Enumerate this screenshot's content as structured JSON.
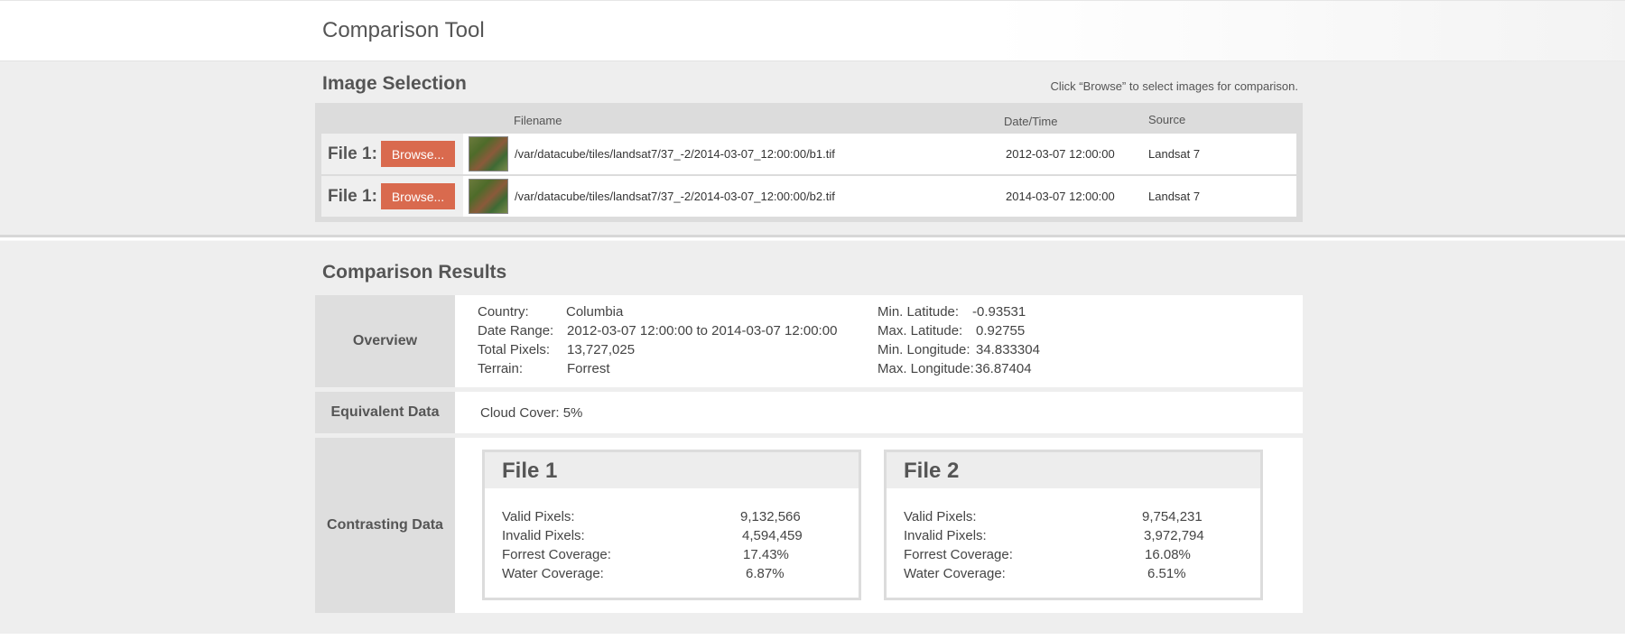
{
  "app": {
    "title": "Comparison Tool"
  },
  "selection": {
    "title": "Image Selection",
    "hint": "Click “Browse” to select images for comparison.",
    "columns": {
      "filename": "Filename",
      "datetime": "Date/Time",
      "source": "Source"
    },
    "rows": [
      {
        "label": "File 1:",
        "button": "Browse...",
        "filename": "/var/datacube/tiles/landsat7/37_-2/2014-03-07_12:00:00/b1.tif",
        "datetime": "2012-03-07 12:00:00",
        "source": "Landsat 7"
      },
      {
        "label": "File 1:",
        "button": "Browse...",
        "filename": "/var/datacube/tiles/landsat7/37_-2/2014-03-07_12:00:00/b2.tif",
        "datetime": "2014-03-07 12:00:00",
        "source": "Landsat 7"
      }
    ]
  },
  "results": {
    "title": "Comparison Results",
    "overview": {
      "label": "Overview",
      "left": [
        {
          "key": "Country:",
          "value": "Columbia"
        },
        {
          "key": "Date Range:",
          "value": "2012-03-07 12:00:00 to 2014-03-07 12:00:00"
        },
        {
          "key": "Total Pixels:",
          "value": "13,727,025"
        },
        {
          "key": "Terrain:",
          "value": "Forrest"
        }
      ],
      "right": [
        {
          "key": "Min. Latitude:",
          "value": "-0.93531"
        },
        {
          "key": "Max. Latitude:",
          "value": "0.92755"
        },
        {
          "key": "Min. Longitude:",
          "value": "34.833304"
        },
        {
          "key": "Max. Longitude:",
          "value": "36.87404"
        }
      ]
    },
    "equivalent": {
      "label": "Equivalent Data",
      "text": "Cloud Cover: 5%"
    },
    "contrasting": {
      "label": "Contrasting Data",
      "cards": [
        {
          "title": "File 1",
          "stats": [
            {
              "key": "Valid Pixels:",
              "value": "9,132,566"
            },
            {
              "key": "Invalid Pixels:",
              "value": "4,594,459"
            },
            {
              "key": "Forrest Coverage:",
              "value": "17.43%"
            },
            {
              "key": "Water Coverage:",
              "value": "6.87%"
            }
          ]
        },
        {
          "title": "File 2",
          "stats": [
            {
              "key": "Valid Pixels:",
              "value": "9,754,231"
            },
            {
              "key": "Invalid Pixels:",
              "value": "3,972,794"
            },
            {
              "key": "Forrest Coverage:",
              "value": "16.08%"
            },
            {
              "key": "Water Coverage:",
              "value": "6.51%"
            }
          ]
        }
      ]
    }
  }
}
